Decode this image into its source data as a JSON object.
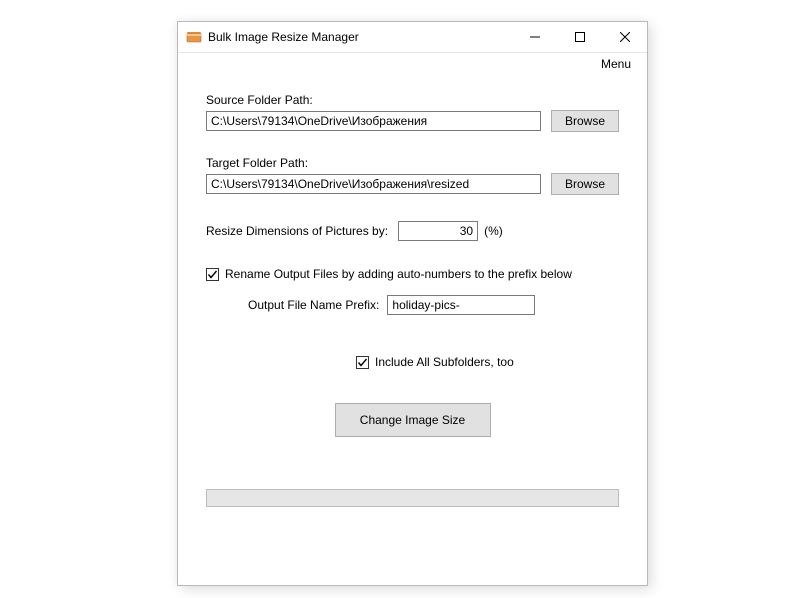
{
  "window": {
    "title": "Bulk Image Resize Manager"
  },
  "menu": {
    "label": "Menu"
  },
  "source": {
    "label": "Source Folder Path:",
    "value": "C:\\Users\\79134\\OneDrive\\Изображения",
    "browse": "Browse"
  },
  "target": {
    "label": "Target Folder Path:",
    "value": "C:\\Users\\79134\\OneDrive\\Изображения\\resized",
    "browse": "Browse"
  },
  "resize": {
    "label": "Resize Dimensions of Pictures by:",
    "value": "30",
    "unit": "(%)"
  },
  "rename": {
    "checked": true,
    "label": "Rename Output Files by adding auto-numbers to the prefix below"
  },
  "prefix": {
    "label": "Output File Name Prefix:",
    "value": "holiday-pics-"
  },
  "subfolders": {
    "checked": true,
    "label": "Include All Subfolders, too"
  },
  "action": {
    "label": "Change Image Size"
  }
}
